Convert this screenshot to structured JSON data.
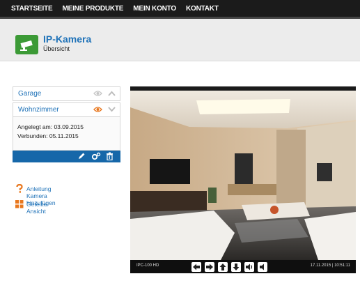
{
  "nav": [
    "STARTSEITE",
    "MEINE PRODUKTE",
    "MEIN KONTO",
    "KONTAKT"
  ],
  "header": {
    "title": "IP-Kamera",
    "subtitle": "Übersicht"
  },
  "cameras": [
    {
      "label": "Garage",
      "visible": false,
      "expanded": false
    },
    {
      "label": "Wohnzimmer",
      "visible": true,
      "expanded": true
    }
  ],
  "details": {
    "created": "Angelegt am: 03.09.2015",
    "connected": "Verbunden: 05.11.2015"
  },
  "links": {
    "guide": "Anleitung Kamera hinzufügen",
    "split": "Geteilte Ansicht"
  },
  "video": {
    "camera_id": "IPC-100 HD",
    "timestamp": "17.11.2015 | 10:51:11"
  },
  "colors": {
    "accent": "#1f72b8",
    "toolbar": "#1667a9",
    "icon_green": "#3c9a36",
    "warn": "#e8771e"
  }
}
